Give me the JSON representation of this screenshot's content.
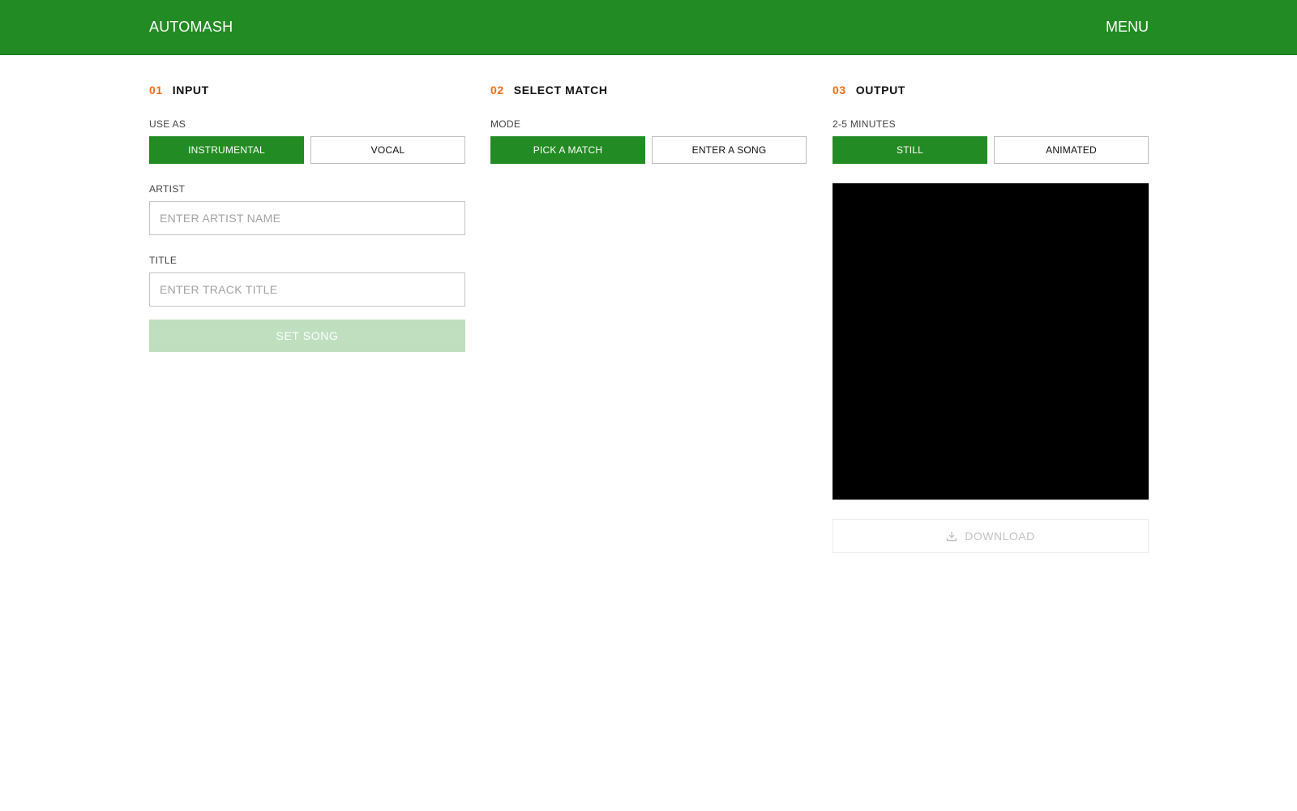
{
  "header": {
    "brand": "AUTOMASH",
    "menu_label": "MENU",
    "colors": {
      "primary": "#238b23",
      "accent": "#f26c16"
    }
  },
  "sections": {
    "input": {
      "number": "01",
      "title": "INPUT",
      "use_as_label": "USE AS",
      "options": [
        "INSTRUMENTAL",
        "VOCAL"
      ],
      "selected": "INSTRUMENTAL",
      "artist_label": "ARTIST",
      "artist_placeholder": "ENTER ARTIST NAME",
      "artist_value": "",
      "title_label": "TITLE",
      "title_placeholder": "ENTER TRACK TITLE",
      "title_value": "",
      "set_song_label": "SET SONG"
    },
    "select_match": {
      "number": "02",
      "title": "SELECT MATCH",
      "mode_label": "MODE",
      "options": [
        "PICK A MATCH",
        "ENTER A SONG"
      ],
      "selected": "PICK A MATCH"
    },
    "output": {
      "number": "03",
      "title": "OUTPUT",
      "duration_label": "2-5 MINUTES",
      "options": [
        "STILL",
        "ANIMATED"
      ],
      "selected": "STILL",
      "download_label": "DOWNLOAD",
      "download_icon": "download-icon"
    }
  }
}
